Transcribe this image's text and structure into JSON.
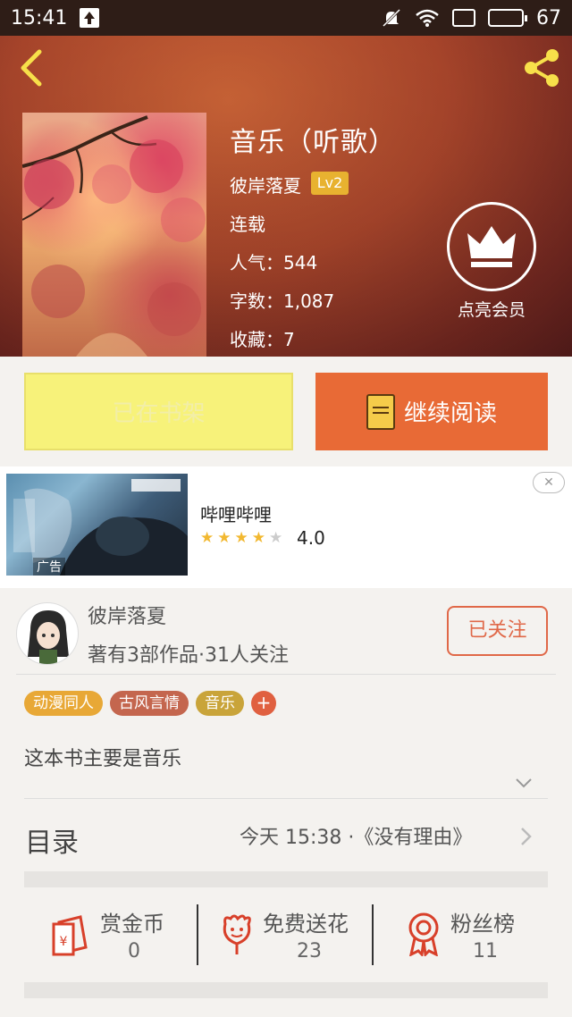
{
  "status_bar": {
    "time": "15:41",
    "battery": "67",
    "battery_level": 0.67
  },
  "book": {
    "title": "音乐（听歌）",
    "author": "彼岸落夏",
    "level": "Lv2",
    "status": "连载",
    "popularity": "人气：544",
    "word_count": "字数：1,087",
    "favorites": "收藏：7"
  },
  "vip": {
    "label": "点亮会员",
    "icon": "crown-icon"
  },
  "actions": {
    "shelf_label": "已在书架",
    "read_label": "继续阅读"
  },
  "ad": {
    "app_name": "哔哩哔哩",
    "rating": "4.0",
    "stars_filled": 4,
    "stars_total": 5,
    "tag": "广告"
  },
  "author_card": {
    "name": "彼岸落夏",
    "meta": "著有3部作品·31人关注",
    "follow_label": "已关注"
  },
  "tags": [
    {
      "label": "动漫同人",
      "color": "#e8a836"
    },
    {
      "label": "古风言情",
      "color": "#c4664e"
    },
    {
      "label": "音乐",
      "color": "#c9a43a"
    }
  ],
  "summary": "这本书主要是音乐",
  "toc": {
    "label": "目录",
    "latest_time": "今天 15:38 · ",
    "latest_chapter": "《没有理由》"
  },
  "stats": [
    {
      "label": "赏金币",
      "value": "0",
      "icon": "red-envelope-icon"
    },
    {
      "label": "免费送花",
      "value": "23",
      "icon": "flower-icon"
    },
    {
      "label": "粉丝榜",
      "value": "11",
      "icon": "medal-icon"
    }
  ],
  "colors": {
    "accent": "#e86a36",
    "shelf_bg": "#f7f27a",
    "icon_red": "#d8402a"
  }
}
